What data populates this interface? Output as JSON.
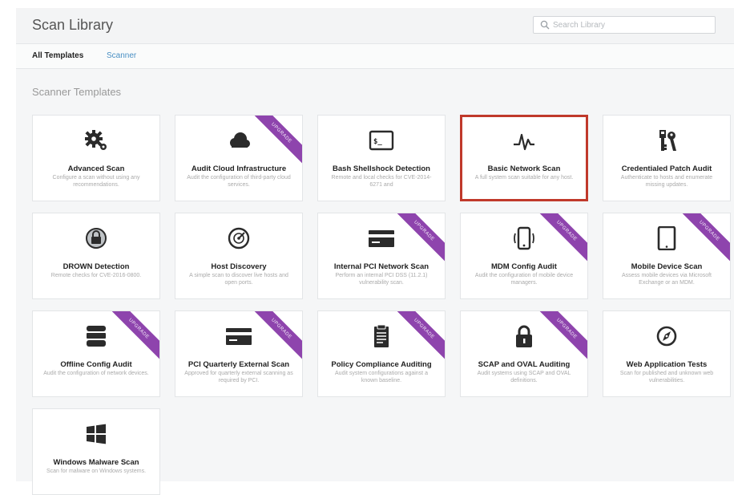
{
  "header": {
    "title": "Scan Library",
    "search_placeholder": "Search Library"
  },
  "tabs": [
    {
      "label": "All Templates",
      "active": true
    },
    {
      "label": "Scanner",
      "active": false
    }
  ],
  "section_title": "Scanner Templates",
  "ribbon_label": "UPGRADE",
  "colors": {
    "ribbon": "#8e44ad",
    "highlight": "#c0392b",
    "link": "#4a90c4"
  },
  "templates": [
    {
      "title": "Advanced Scan",
      "desc": "Configure a scan without using any recommendations.",
      "icon": "gears-icon",
      "upgrade": false,
      "highlighted": false
    },
    {
      "title": "Audit Cloud Infrastructure",
      "desc": "Audit the configuration of third-party cloud services.",
      "icon": "cloud-icon",
      "upgrade": true,
      "highlighted": false
    },
    {
      "title": "Bash Shellshock Detection",
      "desc": "Remote and local checks for CVE-2014-6271 and",
      "icon": "terminal-icon",
      "upgrade": false,
      "highlighted": false
    },
    {
      "title": "Basic Network Scan",
      "desc": "A full system scan suitable for any host.",
      "icon": "pulse-icon",
      "upgrade": false,
      "highlighted": true
    },
    {
      "title": "Credentialed Patch Audit",
      "desc": "Authenticate to hosts and enumerate missing updates.",
      "icon": "keys-icon",
      "upgrade": false,
      "highlighted": false
    },
    {
      "title": "DROWN Detection",
      "desc": "Remote checks for CVE-2016-0800.",
      "icon": "drown-icon",
      "upgrade": false,
      "highlighted": false
    },
    {
      "title": "Host Discovery",
      "desc": "A simple scan to discover live hosts and open ports.",
      "icon": "radar-icon",
      "upgrade": false,
      "highlighted": false
    },
    {
      "title": "Internal PCI Network Scan",
      "desc": "Perform an internal PCI DSS (11.2.1) vulnerability scan.",
      "icon": "credit-card-icon",
      "upgrade": true,
      "highlighted": false
    },
    {
      "title": "MDM Config Audit",
      "desc": "Audit the configuration of mobile device managers.",
      "icon": "mobile-vibrate-icon",
      "upgrade": true,
      "highlighted": false
    },
    {
      "title": "Mobile Device Scan",
      "desc": "Assess mobile devices via Microsoft Exchange or an MDM.",
      "icon": "tablet-icon",
      "upgrade": true,
      "highlighted": false
    },
    {
      "title": "Offline Config Audit",
      "desc": "Audit the configuration of network devices.",
      "icon": "database-icon",
      "upgrade": true,
      "highlighted": false
    },
    {
      "title": "PCI Quarterly External Scan",
      "desc": "Approved for quarterly external scanning as required by PCI.",
      "icon": "credit-card-icon",
      "upgrade": true,
      "highlighted": false
    },
    {
      "title": "Policy Compliance Auditing",
      "desc": "Audit system configurations against a known baseline.",
      "icon": "clipboard-icon",
      "upgrade": true,
      "highlighted": false
    },
    {
      "title": "SCAP and OVAL Auditing",
      "desc": "Audit systems using SCAP and OVAL definitions.",
      "icon": "lock-icon",
      "upgrade": true,
      "highlighted": false
    },
    {
      "title": "Web Application Tests",
      "desc": "Scan for published and unknown web vulnerabilities.",
      "icon": "compass-icon",
      "upgrade": false,
      "highlighted": false
    },
    {
      "title": "Windows Malware Scan",
      "desc": "Scan for malware on Windows systems.",
      "icon": "windows-icon",
      "upgrade": false,
      "highlighted": false
    }
  ]
}
